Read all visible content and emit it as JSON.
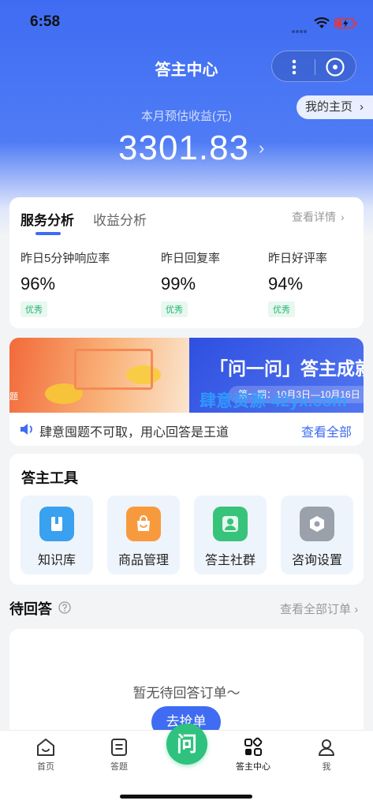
{
  "status_bar": {
    "time": "6:58"
  },
  "header": {
    "title": "答主中心",
    "homepage_label": "我的主页"
  },
  "earnings": {
    "label": "本月预估收益(元)",
    "value": "3301.83"
  },
  "stats": {
    "tabs": [
      "服务分析",
      "收益分析"
    ],
    "details_link": "查看详情",
    "items": [
      {
        "label": "昨日5分钟响应率",
        "value": "96%",
        "badge": "优秀"
      },
      {
        "label": "昨日回复率",
        "value": "99%",
        "badge": "优秀"
      },
      {
        "label": "昨日好评率",
        "value": "94%",
        "badge": "优秀"
      }
    ]
  },
  "banner": {
    "title": "「问一问」答主成就",
    "date_range": "第一期：10月3日—10月16日",
    "edge_text": "题",
    "watermark": "肆意资源-42yx.com"
  },
  "notice": {
    "text": "肆意囤题不可取，用心回答是王道",
    "link": "查看全部"
  },
  "tools": {
    "title": "答主工具",
    "items": [
      {
        "label": "知识库",
        "color": "#3aa0f0"
      },
      {
        "label": "商品管理",
        "color": "#f79a3e"
      },
      {
        "label": "答主社群",
        "color": "#37c37a"
      },
      {
        "label": "咨询设置",
        "color": "#9aa1ab"
      }
    ]
  },
  "pending": {
    "title": "待回答",
    "link": "查看全部订单",
    "empty_text": "暂无待回答订单～",
    "button": "去抢单"
  },
  "tabbar": {
    "items": [
      "首页",
      "答题",
      "答主中心",
      "我"
    ],
    "center_label": "问",
    "active": "答主中心"
  },
  "colors": {
    "primary": "#3f6cf2",
    "ask_green": "#2ec27e",
    "badge_green": "#22b573"
  }
}
